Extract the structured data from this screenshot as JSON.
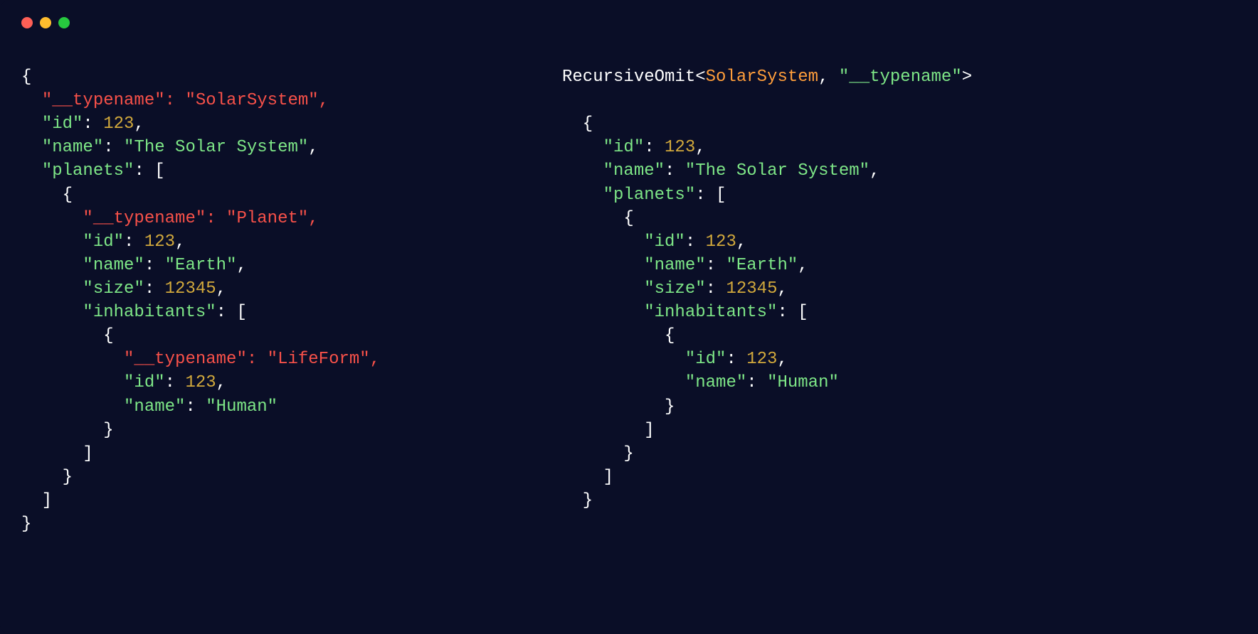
{
  "colors": {
    "background": "#0a0e27",
    "traffic_red": "#ff5f56",
    "traffic_yellow": "#ffbd2e",
    "traffic_green": "#27c93f",
    "token_green": "#7ee787",
    "token_number": "#d2a93c",
    "token_red": "#f85149",
    "token_orange": "#ff9e3b",
    "token_white": "#ffffff"
  },
  "header_type_expression": {
    "util": "RecursiveOmit",
    "generic_type": "SolarSystem",
    "omit_key": "\"__typename\""
  },
  "left_object": {
    "__typename": "SolarSystem",
    "id": 123,
    "name": "The Solar System",
    "planets": [
      {
        "__typename": "Planet",
        "id": 123,
        "name": "Earth",
        "size": 12345,
        "inhabitants": [
          {
            "__typename": "LifeForm",
            "id": 123,
            "name": "Human"
          }
        ]
      }
    ]
  },
  "right_object": {
    "id": 123,
    "name": "The Solar System",
    "planets": [
      {
        "id": 123,
        "name": "Earth",
        "size": 12345,
        "inhabitants": [
          {
            "id": 123,
            "name": "Human"
          }
        ]
      }
    ]
  },
  "left_lines": [
    [
      {
        "t": "{",
        "c": "punc"
      }
    ],
    [
      {
        "t": "  ",
        "c": "punc"
      },
      {
        "t": "\"__typename\": \"SolarSystem\",",
        "c": "red"
      }
    ],
    [
      {
        "t": "  ",
        "c": "punc"
      },
      {
        "t": "\"id\"",
        "c": "key"
      },
      {
        "t": ": ",
        "c": "punc"
      },
      {
        "t": "123",
        "c": "num"
      },
      {
        "t": ",",
        "c": "punc"
      }
    ],
    [
      {
        "t": "  ",
        "c": "punc"
      },
      {
        "t": "\"name\"",
        "c": "key"
      },
      {
        "t": ": ",
        "c": "punc"
      },
      {
        "t": "\"The Solar System\"",
        "c": "str"
      },
      {
        "t": ",",
        "c": "punc"
      }
    ],
    [
      {
        "t": "  ",
        "c": "punc"
      },
      {
        "t": "\"planets\"",
        "c": "key"
      },
      {
        "t": ": [",
        "c": "punc"
      }
    ],
    [
      {
        "t": "    {",
        "c": "punc"
      }
    ],
    [
      {
        "t": "      ",
        "c": "punc"
      },
      {
        "t": "\"__typename\": \"Planet\",",
        "c": "red"
      }
    ],
    [
      {
        "t": "      ",
        "c": "punc"
      },
      {
        "t": "\"id\"",
        "c": "key"
      },
      {
        "t": ": ",
        "c": "punc"
      },
      {
        "t": "123",
        "c": "num"
      },
      {
        "t": ",",
        "c": "punc"
      }
    ],
    [
      {
        "t": "      ",
        "c": "punc"
      },
      {
        "t": "\"name\"",
        "c": "key"
      },
      {
        "t": ": ",
        "c": "punc"
      },
      {
        "t": "\"Earth\"",
        "c": "str"
      },
      {
        "t": ",",
        "c": "punc"
      }
    ],
    [
      {
        "t": "      ",
        "c": "punc"
      },
      {
        "t": "\"size\"",
        "c": "key"
      },
      {
        "t": ": ",
        "c": "punc"
      },
      {
        "t": "12345",
        "c": "num"
      },
      {
        "t": ",",
        "c": "punc"
      }
    ],
    [
      {
        "t": "      ",
        "c": "punc"
      },
      {
        "t": "\"inhabitants\"",
        "c": "key"
      },
      {
        "t": ": [",
        "c": "punc"
      }
    ],
    [
      {
        "t": "        {",
        "c": "punc"
      }
    ],
    [
      {
        "t": "          ",
        "c": "punc"
      },
      {
        "t": "\"__typename\": \"LifeForm\",",
        "c": "red"
      }
    ],
    [
      {
        "t": "          ",
        "c": "punc"
      },
      {
        "t": "\"id\"",
        "c": "key"
      },
      {
        "t": ": ",
        "c": "punc"
      },
      {
        "t": "123",
        "c": "num"
      },
      {
        "t": ",",
        "c": "punc"
      }
    ],
    [
      {
        "t": "          ",
        "c": "punc"
      },
      {
        "t": "\"name\"",
        "c": "key"
      },
      {
        "t": ": ",
        "c": "punc"
      },
      {
        "t": "\"Human\"",
        "c": "str"
      }
    ],
    [
      {
        "t": "        }",
        "c": "punc"
      }
    ],
    [
      {
        "t": "      ]",
        "c": "punc"
      }
    ],
    [
      {
        "t": "    }",
        "c": "punc"
      }
    ],
    [
      {
        "t": "  ]",
        "c": "punc"
      }
    ],
    [
      {
        "t": "}",
        "c": "punc"
      }
    ]
  ],
  "right_header_line": [
    {
      "t": "RecursiveOmit",
      "c": "punc"
    },
    {
      "t": "<",
      "c": "punc"
    },
    {
      "t": "SolarSystem",
      "c": "type"
    },
    {
      "t": ", ",
      "c": "punc"
    },
    {
      "t": "\"__typename\"",
      "c": "key"
    },
    {
      "t": ">",
      "c": "punc"
    }
  ],
  "right_lines": [
    [
      {
        "t": "  {",
        "c": "punc"
      }
    ],
    [
      {
        "t": "    ",
        "c": "punc"
      },
      {
        "t": "\"id\"",
        "c": "key"
      },
      {
        "t": ": ",
        "c": "punc"
      },
      {
        "t": "123",
        "c": "num"
      },
      {
        "t": ",",
        "c": "punc"
      }
    ],
    [
      {
        "t": "    ",
        "c": "punc"
      },
      {
        "t": "\"name\"",
        "c": "key"
      },
      {
        "t": ": ",
        "c": "punc"
      },
      {
        "t": "\"The Solar System\"",
        "c": "str"
      },
      {
        "t": ",",
        "c": "punc"
      }
    ],
    [
      {
        "t": "    ",
        "c": "punc"
      },
      {
        "t": "\"planets\"",
        "c": "key"
      },
      {
        "t": ": [",
        "c": "punc"
      }
    ],
    [
      {
        "t": "      {",
        "c": "punc"
      }
    ],
    [
      {
        "t": "        ",
        "c": "punc"
      },
      {
        "t": "\"id\"",
        "c": "key"
      },
      {
        "t": ": ",
        "c": "punc"
      },
      {
        "t": "123",
        "c": "num"
      },
      {
        "t": ",",
        "c": "punc"
      }
    ],
    [
      {
        "t": "        ",
        "c": "punc"
      },
      {
        "t": "\"name\"",
        "c": "key"
      },
      {
        "t": ": ",
        "c": "punc"
      },
      {
        "t": "\"Earth\"",
        "c": "str"
      },
      {
        "t": ",",
        "c": "punc"
      }
    ],
    [
      {
        "t": "        ",
        "c": "punc"
      },
      {
        "t": "\"size\"",
        "c": "key"
      },
      {
        "t": ": ",
        "c": "punc"
      },
      {
        "t": "12345",
        "c": "num"
      },
      {
        "t": ",",
        "c": "punc"
      }
    ],
    [
      {
        "t": "        ",
        "c": "punc"
      },
      {
        "t": "\"inhabitants\"",
        "c": "key"
      },
      {
        "t": ": [",
        "c": "punc"
      }
    ],
    [
      {
        "t": "          {",
        "c": "punc"
      }
    ],
    [
      {
        "t": "            ",
        "c": "punc"
      },
      {
        "t": "\"id\"",
        "c": "key"
      },
      {
        "t": ": ",
        "c": "punc"
      },
      {
        "t": "123",
        "c": "num"
      },
      {
        "t": ",",
        "c": "punc"
      }
    ],
    [
      {
        "t": "            ",
        "c": "punc"
      },
      {
        "t": "\"name\"",
        "c": "key"
      },
      {
        "t": ": ",
        "c": "punc"
      },
      {
        "t": "\"Human\"",
        "c": "str"
      }
    ],
    [
      {
        "t": "          }",
        "c": "punc"
      }
    ],
    [
      {
        "t": "        ]",
        "c": "punc"
      }
    ],
    [
      {
        "t": "      }",
        "c": "punc"
      }
    ],
    [
      {
        "t": "    ]",
        "c": "punc"
      }
    ],
    [
      {
        "t": "  }",
        "c": "punc"
      }
    ]
  ]
}
